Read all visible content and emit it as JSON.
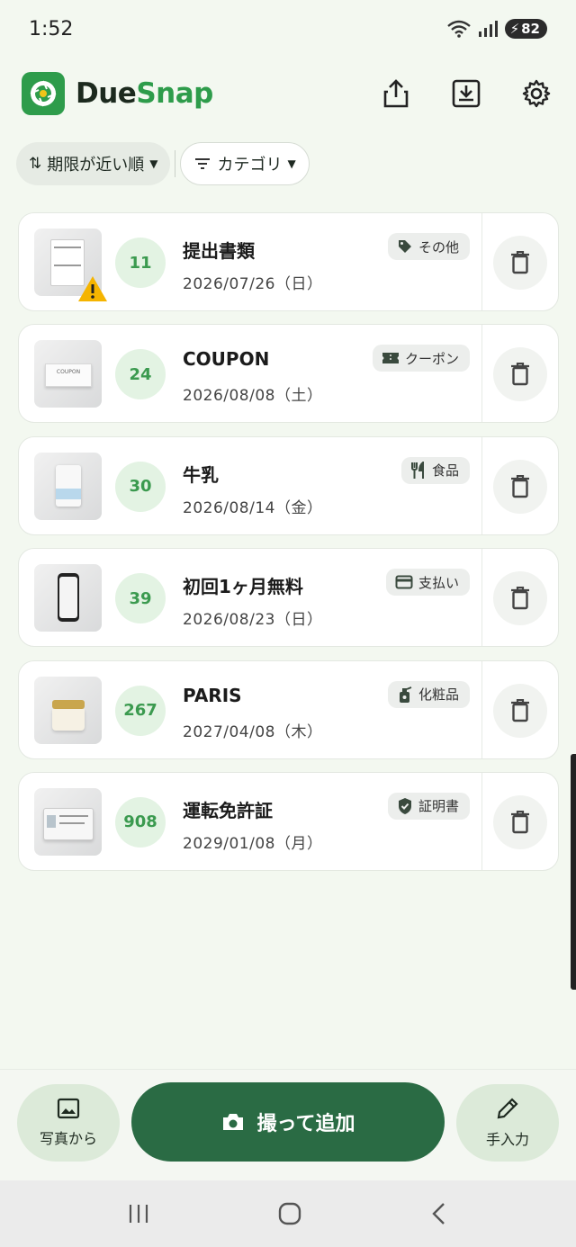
{
  "status": {
    "time": "1:52",
    "battery": "82"
  },
  "app": {
    "title_part1": "Due",
    "title_part2": "Snap"
  },
  "filters": {
    "sort_label": "期限が近い順",
    "category_label": "カテゴリ"
  },
  "items": [
    {
      "days": "11",
      "name": "提出書類",
      "date": "2026/07/26（日）",
      "tag": "その他",
      "tag_icon": "tag-icon",
      "warning": true
    },
    {
      "days": "24",
      "name": "COUPON",
      "date": "2026/08/08（土）",
      "tag": "クーポン",
      "tag_icon": "ticket-icon"
    },
    {
      "days": "30",
      "name": "牛乳",
      "date": "2026/08/14（金）",
      "tag": "食品",
      "tag_icon": "utensils-icon"
    },
    {
      "days": "39",
      "name": "初回1ヶ月無料",
      "date": "2026/08/23（日）",
      "tag": "支払い",
      "tag_icon": "credit-card-icon"
    },
    {
      "days": "267",
      "name": "PARIS",
      "date": "2027/04/08（木）",
      "tag": "化粧品",
      "tag_icon": "spray-bottle-icon"
    },
    {
      "days": "908",
      "name": "運転免許証",
      "date": "2029/01/08（月）",
      "tag": "証明書",
      "tag_icon": "verified-shield-icon"
    }
  ],
  "thumb_text": {
    "coupon": "COUPON"
  },
  "bottom": {
    "photo_label": "写真から",
    "capture_label": "撮って追加",
    "manual_label": "手入力"
  },
  "colors": {
    "accent": "#2e9c4b",
    "primary_button": "#2a6b44",
    "days_bg": "#e3f3e3",
    "background": "#f3f8f0"
  }
}
